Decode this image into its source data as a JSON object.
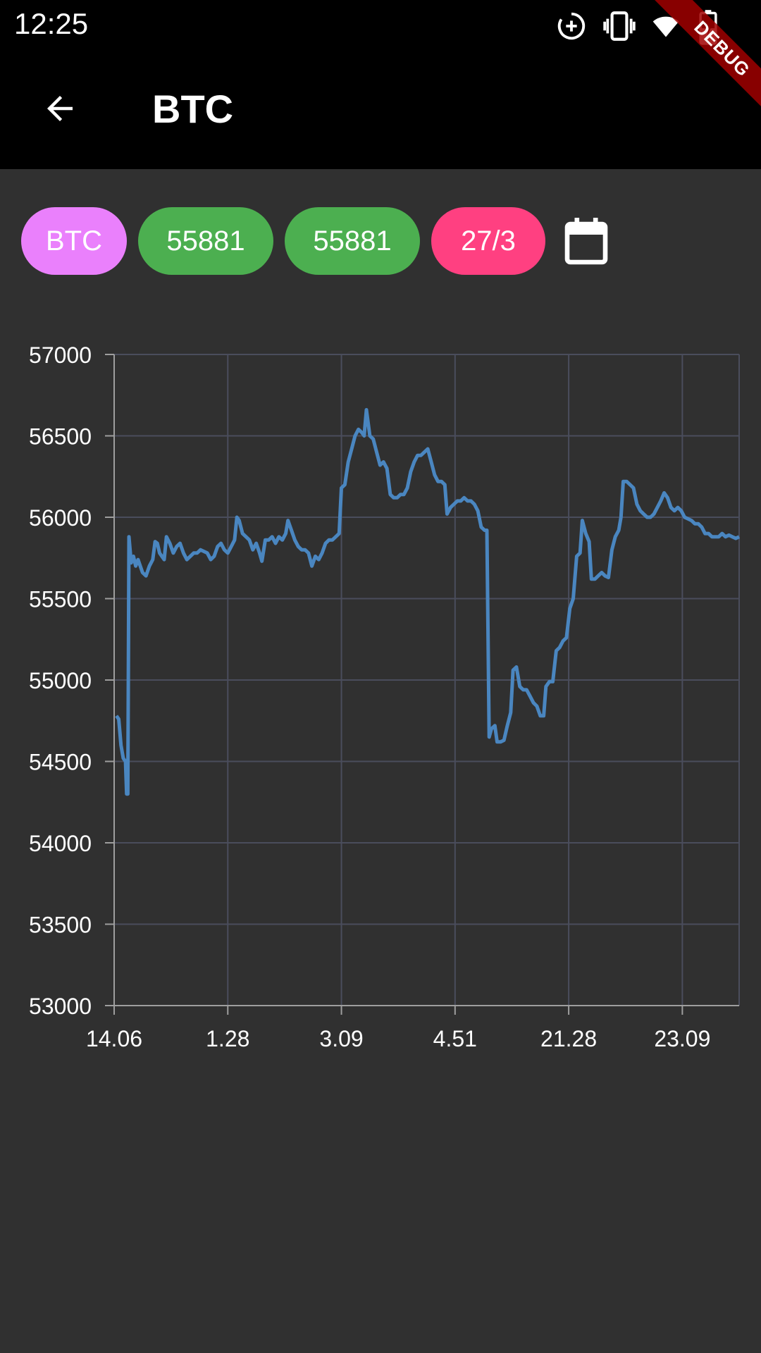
{
  "status_bar": {
    "time": "12:25",
    "icons": [
      "data-saver-icon",
      "vibrate-icon",
      "wifi-icon",
      "battery-charging-icon"
    ]
  },
  "debug_banner": "DEBUG",
  "app_bar": {
    "back_icon": "arrow-back-icon",
    "title": "BTC"
  },
  "chips": {
    "symbol": "BTC",
    "value_1": "55881",
    "value_2": "55881",
    "date": "27/3",
    "calendar_icon": "calendar-icon"
  },
  "colors": {
    "background": "#303030",
    "bar": "#000000",
    "chip_symbol": "#EA80FC",
    "chip_value": "#4CAF50",
    "chip_date": "#FF4081",
    "line": "#4A86C0",
    "grid": "#4A4D5C",
    "axis": "#9E9E9E"
  },
  "chart_data": {
    "type": "line",
    "grid": true,
    "x_tick_labels": [
      "14.06",
      "1.28",
      "3.09",
      "4.51",
      "21.28",
      "23.09"
    ],
    "ylim": [
      53000,
      57000
    ],
    "y_ticks": [
      53000,
      53500,
      54000,
      54500,
      55000,
      55500,
      56000,
      56500,
      57000
    ],
    "xlim": [
      0,
      5.5
    ],
    "series": [
      {
        "points": [
          [
            0.02,
            54780
          ],
          [
            0.04,
            54760
          ],
          [
            0.06,
            54600
          ],
          [
            0.08,
            54520
          ],
          [
            0.1,
            54500
          ],
          [
            0.11,
            54300
          ],
          [
            0.12,
            54300
          ],
          [
            0.13,
            55880
          ],
          [
            0.15,
            55720
          ],
          [
            0.17,
            55760
          ],
          [
            0.19,
            55700
          ],
          [
            0.21,
            55740
          ],
          [
            0.23,
            55700
          ],
          [
            0.25,
            55660
          ],
          [
            0.28,
            55640
          ],
          [
            0.31,
            55700
          ],
          [
            0.34,
            55740
          ],
          [
            0.36,
            55850
          ],
          [
            0.38,
            55840
          ],
          [
            0.4,
            55780
          ],
          [
            0.42,
            55760
          ],
          [
            0.44,
            55740
          ],
          [
            0.46,
            55880
          ],
          [
            0.49,
            55840
          ],
          [
            0.52,
            55780
          ],
          [
            0.55,
            55820
          ],
          [
            0.58,
            55840
          ],
          [
            0.61,
            55780
          ],
          [
            0.64,
            55740
          ],
          [
            0.67,
            55760
          ],
          [
            0.7,
            55780
          ],
          [
            0.73,
            55780
          ],
          [
            0.76,
            55800
          ],
          [
            0.79,
            55790
          ],
          [
            0.82,
            55780
          ],
          [
            0.85,
            55740
          ],
          [
            0.88,
            55760
          ],
          [
            0.91,
            55820
          ],
          [
            0.94,
            55840
          ],
          [
            0.97,
            55800
          ],
          [
            1.0,
            55780
          ],
          [
            1.03,
            55820
          ],
          [
            1.06,
            55860
          ],
          [
            1.08,
            56000
          ],
          [
            1.1,
            55980
          ],
          [
            1.13,
            55900
          ],
          [
            1.16,
            55880
          ],
          [
            1.19,
            55860
          ],
          [
            1.22,
            55800
          ],
          [
            1.25,
            55840
          ],
          [
            1.28,
            55780
          ],
          [
            1.3,
            55730
          ],
          [
            1.33,
            55860
          ],
          [
            1.36,
            55860
          ],
          [
            1.39,
            55880
          ],
          [
            1.42,
            55840
          ],
          [
            1.45,
            55880
          ],
          [
            1.48,
            55860
          ],
          [
            1.51,
            55900
          ],
          [
            1.53,
            55980
          ],
          [
            1.56,
            55920
          ],
          [
            1.59,
            55860
          ],
          [
            1.62,
            55820
          ],
          [
            1.65,
            55800
          ],
          [
            1.68,
            55800
          ],
          [
            1.71,
            55780
          ],
          [
            1.74,
            55700
          ],
          [
            1.77,
            55760
          ],
          [
            1.8,
            55740
          ],
          [
            1.83,
            55780
          ],
          [
            1.86,
            55840
          ],
          [
            1.89,
            55860
          ],
          [
            1.92,
            55860
          ],
          [
            1.95,
            55880
          ],
          [
            1.98,
            55900
          ],
          [
            2.0,
            56180
          ],
          [
            2.03,
            56200
          ],
          [
            2.06,
            56340
          ],
          [
            2.09,
            56420
          ],
          [
            2.12,
            56500
          ],
          [
            2.15,
            56540
          ],
          [
            2.18,
            56520
          ],
          [
            2.2,
            56500
          ],
          [
            2.22,
            56660
          ],
          [
            2.25,
            56500
          ],
          [
            2.28,
            56480
          ],
          [
            2.31,
            56400
          ],
          [
            2.34,
            56320
          ],
          [
            2.37,
            56340
          ],
          [
            2.4,
            56300
          ],
          [
            2.43,
            56140
          ],
          [
            2.46,
            56120
          ],
          [
            2.49,
            56120
          ],
          [
            2.52,
            56140
          ],
          [
            2.55,
            56140
          ],
          [
            2.58,
            56180
          ],
          [
            2.61,
            56280
          ],
          [
            2.64,
            56340
          ],
          [
            2.67,
            56380
          ],
          [
            2.7,
            56380
          ],
          [
            2.73,
            56400
          ],
          [
            2.76,
            56420
          ],
          [
            2.79,
            56340
          ],
          [
            2.82,
            56260
          ],
          [
            2.85,
            56220
          ],
          [
            2.88,
            56220
          ],
          [
            2.91,
            56200
          ],
          [
            2.93,
            56020
          ],
          [
            2.96,
            56060
          ],
          [
            2.99,
            56080
          ],
          [
            3.02,
            56100
          ],
          [
            3.05,
            56100
          ],
          [
            3.08,
            56120
          ],
          [
            3.11,
            56100
          ],
          [
            3.14,
            56100
          ],
          [
            3.17,
            56080
          ],
          [
            3.2,
            56040
          ],
          [
            3.23,
            55940
          ],
          [
            3.26,
            55920
          ],
          [
            3.28,
            55920
          ],
          [
            3.3,
            54650
          ],
          [
            3.32,
            54700
          ],
          [
            3.35,
            54720
          ],
          [
            3.37,
            54620
          ],
          [
            3.4,
            54620
          ],
          [
            3.43,
            54630
          ],
          [
            3.46,
            54720
          ],
          [
            3.49,
            54800
          ],
          [
            3.51,
            55060
          ],
          [
            3.54,
            55080
          ],
          [
            3.57,
            54960
          ],
          [
            3.6,
            54940
          ],
          [
            3.63,
            54940
          ],
          [
            3.66,
            54900
          ],
          [
            3.69,
            54860
          ],
          [
            3.72,
            54840
          ],
          [
            3.75,
            54780
          ],
          [
            3.78,
            54780
          ],
          [
            3.8,
            54960
          ],
          [
            3.83,
            54990
          ],
          [
            3.86,
            54990
          ],
          [
            3.89,
            55180
          ],
          [
            3.92,
            55200
          ],
          [
            3.95,
            55240
          ],
          [
            3.98,
            55260
          ],
          [
            4.01,
            55440
          ],
          [
            4.04,
            55500
          ],
          [
            4.07,
            55760
          ],
          [
            4.1,
            55780
          ],
          [
            4.12,
            55980
          ],
          [
            4.15,
            55900
          ],
          [
            4.18,
            55850
          ],
          [
            4.2,
            55620
          ],
          [
            4.23,
            55620
          ],
          [
            4.26,
            55640
          ],
          [
            4.29,
            55660
          ],
          [
            4.32,
            55640
          ],
          [
            4.35,
            55630
          ],
          [
            4.38,
            55800
          ],
          [
            4.41,
            55880
          ],
          [
            4.44,
            55920
          ],
          [
            4.46,
            56000
          ],
          [
            4.48,
            56220
          ],
          [
            4.51,
            56220
          ],
          [
            4.54,
            56200
          ],
          [
            4.57,
            56180
          ],
          [
            4.6,
            56080
          ],
          [
            4.63,
            56040
          ],
          [
            4.66,
            56020
          ],
          [
            4.69,
            56000
          ],
          [
            4.72,
            56000
          ],
          [
            4.75,
            56020
          ],
          [
            4.78,
            56060
          ],
          [
            4.81,
            56100
          ],
          [
            4.84,
            56150
          ],
          [
            4.87,
            56120
          ],
          [
            4.9,
            56060
          ],
          [
            4.93,
            56040
          ],
          [
            4.96,
            56060
          ],
          [
            4.99,
            56040
          ],
          [
            5.02,
            56000
          ],
          [
            5.05,
            55990
          ],
          [
            5.08,
            55980
          ],
          [
            5.11,
            55960
          ],
          [
            5.14,
            55960
          ],
          [
            5.17,
            55940
          ],
          [
            5.2,
            55900
          ],
          [
            5.23,
            55900
          ],
          [
            5.26,
            55880
          ],
          [
            5.29,
            55880
          ],
          [
            5.32,
            55880
          ],
          [
            5.35,
            55900
          ],
          [
            5.38,
            55880
          ],
          [
            5.41,
            55890
          ],
          [
            5.44,
            55880
          ],
          [
            5.47,
            55870
          ],
          [
            5.5,
            55880
          ]
        ]
      }
    ]
  }
}
